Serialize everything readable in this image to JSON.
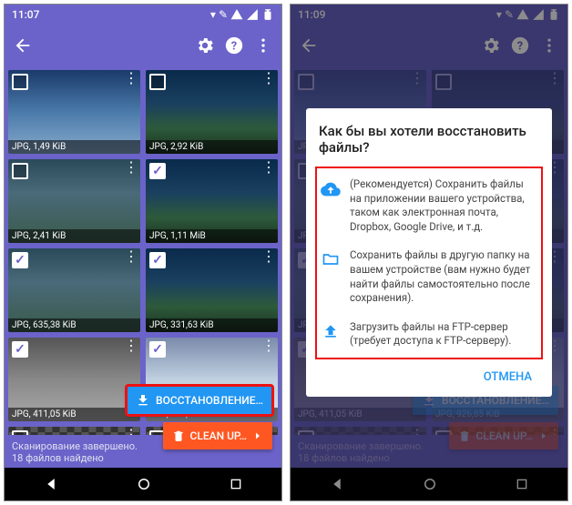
{
  "left": {
    "time": "11:07",
    "tiles": [
      {
        "cap": "JPG, 1,49 KiB",
        "checked": false,
        "variant": "sky"
      },
      {
        "cap": "JPG, 2,92 KiB",
        "checked": false,
        "variant": ""
      },
      {
        "cap": "JPG, 2,41 KiB",
        "checked": false,
        "variant": "cloudy"
      },
      {
        "cap": "JPG, 1,11 MiB",
        "checked": true,
        "variant": ""
      },
      {
        "cap": "JPG, 635,38 KiB",
        "checked": true,
        "variant": "cloudy"
      },
      {
        "cap": "JPG, 331,63 KiB",
        "checked": true,
        "variant": ""
      },
      {
        "cap": "JPG, 411,05 KiB",
        "checked": true,
        "variant": "grey"
      },
      {
        "cap": "JPG, 926,85 KiB",
        "checked": true,
        "variant": "snow"
      },
      {
        "cap": "",
        "checked": false,
        "variant": "checker"
      },
      {
        "cap": "",
        "checked": false,
        "variant": "checker"
      }
    ],
    "restore_label": "ВОССТАНОВЛЕНИЕ…",
    "cleanup_label": "CLEAN UP…",
    "status_line1": "Сканирование завершено.",
    "status_line2": "18 файлов найдено"
  },
  "right": {
    "time": "11:09",
    "dialog": {
      "title": "Как бы вы хотели восстановить файлы?",
      "opt1": "(Рекомендуется) Сохранить файлы на приложении вашего устройства, таком как электронная почта, Dropbox, Google Drive, и т.д.",
      "opt2": "Сохранить файлы в другую папку на вашем устройстве (вам нужно будет найти файлы самостоятельно после сохранения).",
      "opt3": "Загрузить файлы на FTP-сервер (требует доступа к FTP-серверу).",
      "cancel": "ОТМЕНА"
    },
    "restore_label": "ВОССТАНОВЛЕНИЕ…",
    "cleanup_label": "CLEAN UP…",
    "status_line1": "Сканирование завершено.",
    "status_line2": "18 файлов найдено"
  }
}
